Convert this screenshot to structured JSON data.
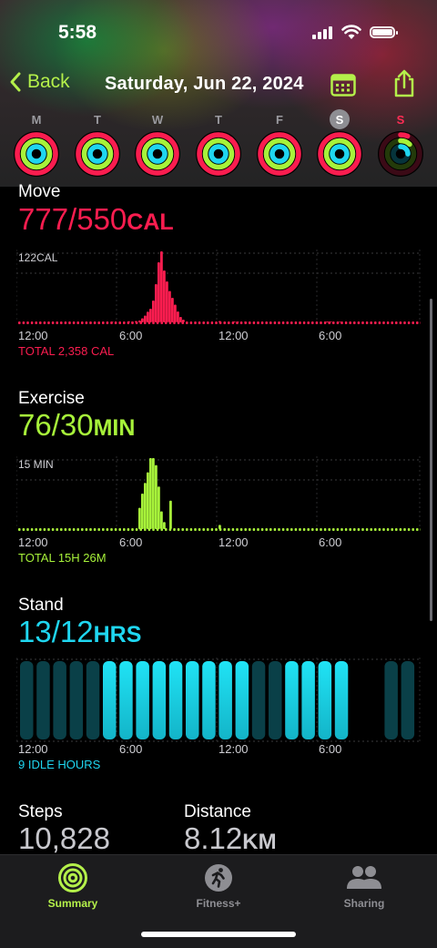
{
  "status": {
    "time": "5:58"
  },
  "nav": {
    "back_label": "Back",
    "title": "Saturday, Jun 22, 2024"
  },
  "week": [
    {
      "letter": "M",
      "move": 1.0,
      "exercise": 1.0,
      "stand": 1.0
    },
    {
      "letter": "T",
      "move": 1.0,
      "exercise": 1.0,
      "stand": 1.0
    },
    {
      "letter": "W",
      "move": 1.0,
      "exercise": 1.0,
      "stand": 1.0
    },
    {
      "letter": "T",
      "move": 1.0,
      "exercise": 1.0,
      "stand": 1.0
    },
    {
      "letter": "F",
      "move": 1.0,
      "exercise": 1.0,
      "stand": 1.0
    },
    {
      "letter": "S",
      "move": 1.0,
      "exercise": 1.0,
      "stand": 1.0,
      "selected": true
    },
    {
      "letter": "S",
      "move": 0.06,
      "exercise": 0.12,
      "stand": 0.25,
      "today": true
    }
  ],
  "move": {
    "title": "Move",
    "value": "777/550",
    "unit": "CAL",
    "scale_label": "122CAL",
    "ticks": [
      "12:00",
      "6:00",
      "12:00",
      "6:00"
    ],
    "total": "TOTAL 2,358 CAL",
    "color": "#fa1d4f",
    "hourly_hint": [
      0,
      0,
      0,
      0,
      0,
      2,
      3,
      5,
      24,
      122,
      60,
      20,
      10,
      4,
      2,
      3,
      2,
      1,
      0,
      1,
      0,
      0,
      0,
      0
    ]
  },
  "exercise": {
    "title": "Exercise",
    "value": "76/30",
    "unit": "MIN",
    "scale_label": "15 MIN",
    "ticks": [
      "12:00",
      "6:00",
      "12:00",
      "6:00"
    ],
    "total": "TOTAL 15H 26M",
    "color": "#a7f23a"
  },
  "stand": {
    "title": "Stand",
    "value": "13/12",
    "unit": "HRS",
    "ticks": [
      "12:00",
      "6:00",
      "12:00",
      "6:00"
    ],
    "idle_label": "9 IDLE HOURS",
    "color": "#1fd6f0",
    "hours": [
      0,
      0,
      0,
      0,
      0,
      1,
      1,
      1,
      1,
      1,
      1,
      1,
      1,
      1,
      0,
      0,
      1,
      1,
      1,
      1,
      -1,
      -1,
      0,
      0
    ]
  },
  "steps": {
    "label": "Steps",
    "value": "10,828"
  },
  "distance": {
    "label": "Distance",
    "value": "8.12",
    "unit": "KM"
  },
  "tabs": [
    {
      "label": "Summary",
      "active": true
    },
    {
      "label": "Fitness+"
    },
    {
      "label": "Sharing"
    }
  ]
}
